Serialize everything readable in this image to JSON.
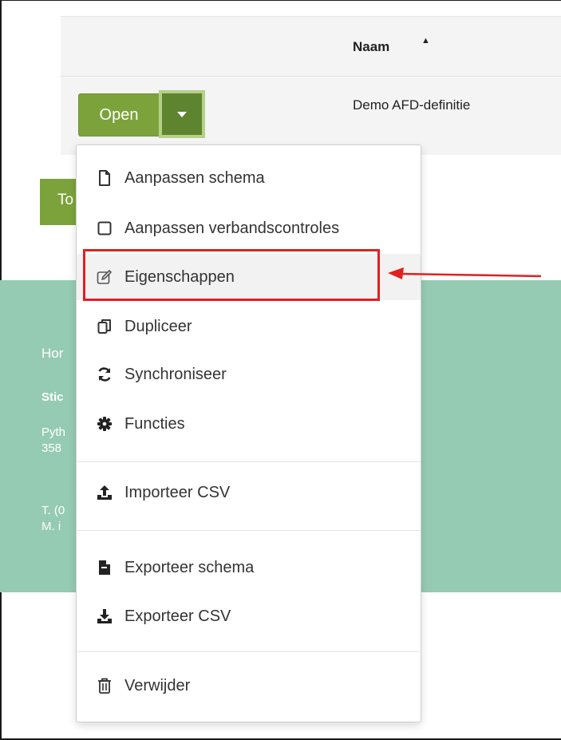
{
  "table": {
    "header_name": "Naam",
    "sort_indicator": "▲",
    "rows": [
      {
        "name": "Demo AFD-definitie"
      }
    ]
  },
  "row_actions": {
    "open_label": "Open",
    "caret_icon": "caret-down-icon",
    "background_button_label": "To"
  },
  "footer": {
    "line1": "Hor",
    "line2": "Stic",
    "line3": "Pyth",
    "line4": "358",
    "line5": "T. (0",
    "line6": "M. i"
  },
  "menu": {
    "items": [
      {
        "label": "Aanpassen schema",
        "icon": "file-icon"
      },
      {
        "label": "Aanpassen verbandscontroles",
        "icon": "square-icon"
      },
      {
        "label": "Eigenschappen",
        "icon": "edit-icon"
      },
      {
        "label": "Dupliceer",
        "icon": "copy-icon"
      },
      {
        "label": "Synchroniseer",
        "icon": "sync-icon"
      },
      {
        "label": "Functies",
        "icon": "cog-icon"
      },
      {
        "label": "Importeer CSV",
        "icon": "upload-icon"
      },
      {
        "label": "Exporteer schema",
        "icon": "export-file-icon"
      },
      {
        "label": "Exporteer CSV",
        "icon": "download-icon"
      },
      {
        "label": "Verwijder",
        "icon": "trash-icon"
      }
    ]
  },
  "colors": {
    "primary_green": "#7ca33b",
    "dark_green": "#5e8430",
    "footer_teal": "#96cbb3",
    "annotation_red": "#e02020"
  }
}
